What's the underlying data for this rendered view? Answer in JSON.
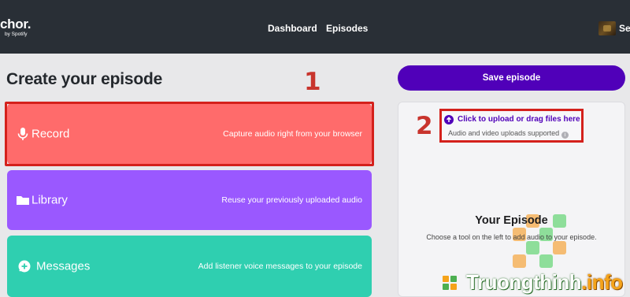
{
  "header": {
    "logo_text": "chor.",
    "logo_subtext": "by Spotify",
    "nav": [
      {
        "label": "Dashboard"
      },
      {
        "label": "Episodes"
      }
    ],
    "settings_partial": "Se"
  },
  "main": {
    "title": "Create your episode",
    "tools": [
      {
        "label": "Record",
        "description": "Capture audio right from your browser",
        "color": "#ff6b6b",
        "icon": "microphone-icon"
      },
      {
        "label": "Library",
        "description": "Reuse your previously uploaded audio",
        "color": "#9a58ff",
        "icon": "folder-icon"
      },
      {
        "label": "Messages",
        "description": "Add listener voice messages to your episode",
        "color": "#2fcfb0",
        "icon": "message-plus-icon"
      }
    ]
  },
  "sidebar": {
    "save_label": "Save episode",
    "upload_link": "Click to upload or drag files here",
    "upload_note": "Audio and video uploads supported",
    "episode_title": "Your Episode",
    "episode_subtitle": "Choose a tool on the left to add audio to your episode."
  },
  "annotations": {
    "one": "1",
    "two": "2"
  },
  "watermark": {
    "name": "Truongthinh",
    "tld": ".info"
  },
  "colors": {
    "accent": "#5000b9",
    "highlight": "#d4211c",
    "nav_bg": "#292f36"
  }
}
